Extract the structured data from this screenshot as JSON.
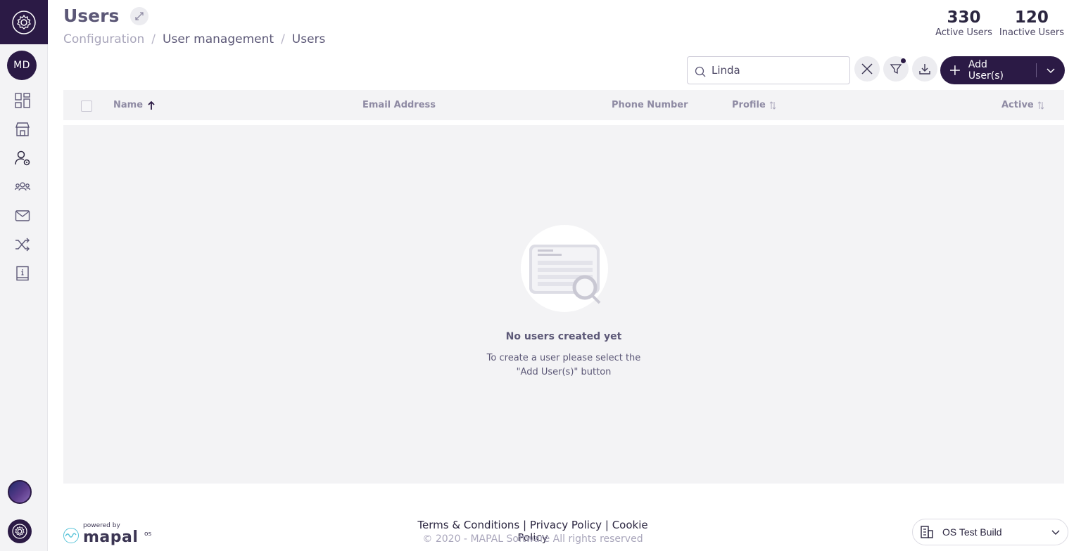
{
  "header": {
    "title": "Users",
    "breadcrumb": [
      "Configuration",
      "User management",
      "Users"
    ]
  },
  "stats": [
    {
      "value": "330",
      "label": "Active Users"
    },
    {
      "value": "120",
      "label": "Inactive Users"
    }
  ],
  "sidebar": {
    "avatar_initials": "MD",
    "icons": [
      "dashboard-icon",
      "store-icon",
      "user-settings-icon",
      "users-group-icon",
      "mail-icon",
      "shuffle-icon",
      "info-book-icon"
    ]
  },
  "toolbar": {
    "search_value": "Linda",
    "add_button_label": "Add User(s)"
  },
  "table": {
    "columns": [
      "Name",
      "Email Address",
      "Phone Number",
      "Profile",
      "Active"
    ],
    "sort_column": "Name",
    "rows": []
  },
  "empty_state": {
    "title": "No users created yet",
    "line1": "To create a user please select the",
    "line2": "\"Add User(s)\" button"
  },
  "footer": {
    "powered_by": "powered by",
    "brand": "mapal",
    "brand_suffix": "os",
    "terms": "Terms & Conditions",
    "privacy": "Privacy Policy",
    "cookie": "Cookie Policy",
    "separator": "|",
    "copyright": "© 2020 - MAPAL Software All rights reserved",
    "build_select_value": "OS Test Build"
  },
  "colors": {
    "brand_dark": "#2b1a45",
    "panel_bg": "#f3f3f5",
    "muted_text": "#8e8aa3"
  }
}
